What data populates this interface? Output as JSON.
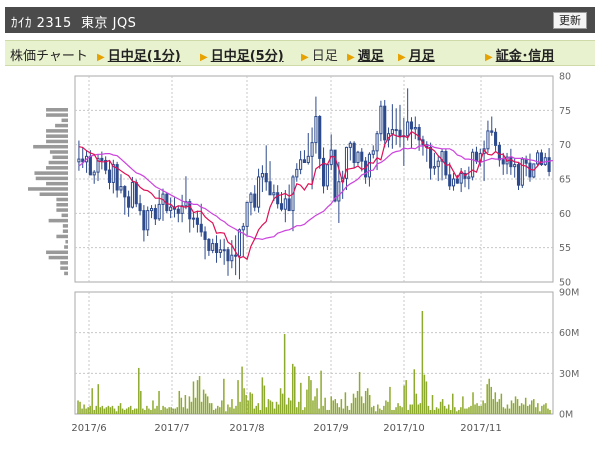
{
  "header": {
    "title": "ｶｲｶ 2315  東京 JQS",
    "refresh_label": "更新"
  },
  "tabs": {
    "label": "株価チャート",
    "items": [
      {
        "label": "日中足(1分)",
        "link": true
      },
      {
        "label": "日中足(5分)",
        "link": true
      },
      {
        "label": "日足",
        "link": false
      },
      {
        "label": "週足",
        "link": true
      },
      {
        "label": "月足",
        "link": true
      },
      {
        "label": "証金･信用",
        "link": true
      }
    ]
  },
  "colors": {
    "candle": "#2d4a8c",
    "ma_short": "#dd1155",
    "ma_long": "#cc44dd",
    "volume": "#8eaa2e",
    "volume_profile": "#999999",
    "grid": "#c8c8c8"
  },
  "chart_data": {
    "type": "candlestick",
    "price_axis": {
      "ticks": [
        "80",
        "75",
        "70",
        "65",
        "60",
        "55",
        "50"
      ],
      "range": [
        50,
        80
      ]
    },
    "volume_axis": {
      "ticks": [
        "90M",
        "60M",
        "30M",
        "0M"
      ],
      "range": [
        0,
        90
      ]
    },
    "x_labels": [
      "2017/6",
      "2017/7",
      "2017/8",
      "2017/9",
      "2017/10",
      "2017/11"
    ],
    "ohlc": [
      [
        67.5,
        70.6,
        66.2,
        67.9
      ],
      [
        67.9,
        69.6,
        66.6,
        67.5
      ],
      [
        67.5,
        69.2,
        65.9,
        68.3
      ],
      [
        68.3,
        69.2,
        65.6,
        65.6
      ],
      [
        65.6,
        66.3,
        64.3,
        66.0
      ],
      [
        66.0,
        68.6,
        64.7,
        68.0
      ],
      [
        68.0,
        69.0,
        66.4,
        67.7
      ],
      [
        67.7,
        68.3,
        65.7,
        66.3
      ],
      [
        66.3,
        67.7,
        63.5,
        64.5
      ],
      [
        64.5,
        67.8,
        62.9,
        67.1
      ],
      [
        67.1,
        67.5,
        62.3,
        63.4
      ],
      [
        63.4,
        65.7,
        62.9,
        63.9
      ],
      [
        63.9,
        64.1,
        59.8,
        62.4
      ],
      [
        62.4,
        63.3,
        59.5,
        60.9
      ],
      [
        60.9,
        65.3,
        60.7,
        64.5
      ],
      [
        64.5,
        64.9,
        60.9,
        61.4
      ],
      [
        61.4,
        62.7,
        59.7,
        60.4
      ],
      [
        60.4,
        61.2,
        55.9,
        57.6
      ],
      [
        57.6,
        61.0,
        56.7,
        60.4
      ],
      [
        60.4,
        61.2,
        59.3,
        60.7
      ],
      [
        60.7,
        61.3,
        58.3,
        59.2
      ],
      [
        59.2,
        63.4,
        58.9,
        61.3
      ],
      [
        61.3,
        63.6,
        58.9,
        62.8
      ],
      [
        62.8,
        63.0,
        60.0,
        60.4
      ],
      [
        60.4,
        62.3,
        59.3,
        60.9
      ],
      [
        60.9,
        62.3,
        59.4,
        60.6
      ],
      [
        60.6,
        61.1,
        58.7,
        60.0
      ],
      [
        60.0,
        62.7,
        58.7,
        61.1
      ],
      [
        61.1,
        65.4,
        60.6,
        61.7
      ],
      [
        61.7,
        62.1,
        57.2,
        59.2
      ],
      [
        59.2,
        60.2,
        57.9,
        59.3
      ],
      [
        59.3,
        60.4,
        57.2,
        58.4
      ],
      [
        58.4,
        61.4,
        56.6,
        57.3
      ],
      [
        57.3,
        58.1,
        53.3,
        56.2
      ],
      [
        56.2,
        56.4,
        53.8,
        54.6
      ],
      [
        54.6,
        56.3,
        54.2,
        55.6
      ],
      [
        55.6,
        56.8,
        52.8,
        54.3
      ],
      [
        54.3,
        56.2,
        53.5,
        54.7
      ],
      [
        54.7,
        56.3,
        52.5,
        54.7
      ],
      [
        54.7,
        55.1,
        50.9,
        53.1
      ],
      [
        53.1,
        56.1,
        52.0,
        53.9
      ],
      [
        53.9,
        56.8,
        51.0,
        53.8
      ],
      [
        53.8,
        57.8,
        50.4,
        57.6
      ],
      [
        57.6,
        58.6,
        53.7,
        58.1
      ],
      [
        58.1,
        61.6,
        56.8,
        61.6
      ],
      [
        61.6,
        63.1,
        59.7,
        62.8
      ],
      [
        62.8,
        64.1,
        60.3,
        60.9
      ],
      [
        60.9,
        66.5,
        60.1,
        65.3
      ],
      [
        65.3,
        67.0,
        63.1,
        65.8
      ],
      [
        65.8,
        69.9,
        63.3,
        64.6
      ],
      [
        64.6,
        67.6,
        62.7,
        62.7
      ],
      [
        62.7,
        64.2,
        61.8,
        63.0
      ],
      [
        63.0,
        64.1,
        60.7,
        61.4
      ],
      [
        61.4,
        63.1,
        60.3,
        60.6
      ],
      [
        60.6,
        63.4,
        58.7,
        62.1
      ],
      [
        62.1,
        64.2,
        60.5,
        60.4
      ],
      [
        60.4,
        65.6,
        57.4,
        65.3
      ],
      [
        65.3,
        67.3,
        64.6,
        66.4
      ],
      [
        66.4,
        69.1,
        65.7,
        67.8
      ],
      [
        67.8,
        69.2,
        67.4,
        67.4
      ],
      [
        67.4,
        71.7,
        67.1,
        68.3
      ],
      [
        68.3,
        72.5,
        63.5,
        70.3
      ],
      [
        70.3,
        77.0,
        68.7,
        74.1
      ],
      [
        74.1,
        74.3,
        66.5,
        68.0
      ],
      [
        68.0,
        69.6,
        62.9,
        64.0
      ],
      [
        64.0,
        67.2,
        63.4,
        67.1
      ],
      [
        67.1,
        71.5,
        66.3,
        69.2
      ],
      [
        69.2,
        69.2,
        61.6,
        61.8
      ],
      [
        61.8,
        67.5,
        58.6,
        64.6
      ],
      [
        64.6,
        66.2,
        62.1,
        65.1
      ],
      [
        65.1,
        69.7,
        63.4,
        69.6
      ],
      [
        69.6,
        70.5,
        67.7,
        70.2
      ],
      [
        70.2,
        70.5,
        66.6,
        67.4
      ],
      [
        67.4,
        69.1,
        67.0,
        68.9
      ],
      [
        68.9,
        69.5,
        66.1,
        67.6
      ],
      [
        67.6,
        68.2,
        64.3,
        65.3
      ],
      [
        65.3,
        68.9,
        63.9,
        68.6
      ],
      [
        68.6,
        69.9,
        68.0,
        69.1
      ],
      [
        69.1,
        72.0,
        66.3,
        71.6
      ],
      [
        71.6,
        76.4,
        70.5,
        75.6
      ],
      [
        75.6,
        76.5,
        69.6,
        70.7
      ],
      [
        70.7,
        72.5,
        69.6,
        71.6
      ],
      [
        71.6,
        75.9,
        69.4,
        72.2
      ],
      [
        72.2,
        75.3,
        70.0,
        72.1
      ],
      [
        72.1,
        75.8,
        69.6,
        71.2
      ],
      [
        71.2,
        73.9,
        66.9,
        71.3
      ],
      [
        71.3,
        78.2,
        70.6,
        73.3
      ],
      [
        73.3,
        74.0,
        69.5,
        72.3
      ],
      [
        72.3,
        74.1,
        70.8,
        72.5
      ],
      [
        72.5,
        73.0,
        69.1,
        70.7
      ],
      [
        70.7,
        71.3,
        68.4,
        70.0
      ],
      [
        70.0,
        70.5,
        67.5,
        69.6
      ],
      [
        69.6,
        70.3,
        64.9,
        66.6
      ],
      [
        66.6,
        68.8,
        65.6,
        66.8
      ],
      [
        66.8,
        68.3,
        64.7,
        67.6
      ],
      [
        67.6,
        69.4,
        64.8,
        69.0
      ],
      [
        69.0,
        69.4,
        65.0,
        65.6
      ],
      [
        65.6,
        67.4,
        63.4,
        64.0
      ],
      [
        64.0,
        65.9,
        63.3,
        65.0
      ],
      [
        65.0,
        65.6,
        64.3,
        64.4
      ],
      [
        64.4,
        66.6,
        63.1,
        65.8
      ],
      [
        65.8,
        66.3,
        63.8,
        65.1
      ],
      [
        65.1,
        66.8,
        63.5,
        65.3
      ],
      [
        65.3,
        69.4,
        64.8,
        68.9
      ],
      [
        68.9,
        69.7,
        67.2,
        67.6
      ],
      [
        67.6,
        69.4,
        66.8,
        68.7
      ],
      [
        68.7,
        70.6,
        64.7,
        69.4
      ],
      [
        69.4,
        73.5,
        68.8,
        72.0
      ],
      [
        72.0,
        74.1,
        71.3,
        71.8
      ],
      [
        71.8,
        72.4,
        69.1,
        69.9
      ],
      [
        69.9,
        70.4,
        66.8,
        67.8
      ],
      [
        67.8,
        68.8,
        65.6,
        67.2
      ],
      [
        67.2,
        68.8,
        65.7,
        68.2
      ],
      [
        68.2,
        69.4,
        65.6,
        66.8
      ],
      [
        66.8,
        68.1,
        65.2,
        67.1
      ],
      [
        67.1,
        67.5,
        63.4,
        64.1
      ],
      [
        64.1,
        68.2,
        63.7,
        67.9
      ],
      [
        67.9,
        68.4,
        65.4,
        67.3
      ],
      [
        67.3,
        68.7,
        64.6,
        65.3
      ],
      [
        65.3,
        67.2,
        65.1,
        67.2
      ],
      [
        67.2,
        69.2,
        66.8,
        68.8
      ],
      [
        68.8,
        69.3,
        66.9,
        67.1
      ],
      [
        67.1,
        68.8,
        66.9,
        68.1
      ],
      [
        68.1,
        69.5,
        65.4,
        66.1
      ]
    ],
    "ma_short": [
      69.7,
      69.6,
      69.1,
      68.8,
      68.6,
      67.6,
      67.5,
      67.5,
      67.7,
      66.8,
      66.6,
      66.2,
      65.8,
      65.5,
      64.7,
      64.5,
      63.8,
      63.4,
      63.3,
      62.9,
      62.2,
      62.2,
      62.0,
      61.4,
      61.3,
      60.8,
      61.1,
      61.0,
      60.9,
      61.1,
      60.1,
      60.3,
      60.3,
      59.5,
      59.0,
      58.6,
      57.1,
      57.2,
      57.1,
      55.8,
      55.4,
      54.4,
      53.5,
      53.7,
      53.3,
      55.2,
      56.3,
      57.6,
      58.3,
      58.8,
      60.9,
      62.1,
      62.6,
      62.7,
      62.9,
      62.5,
      62.8,
      64.3,
      64.1,
      63.4,
      64.3,
      64.2,
      66.5,
      66.9,
      67.3,
      67.1,
      68.3,
      68.2,
      66.5,
      64.5,
      66.4,
      66.5,
      66.6,
      66.9,
      66.4,
      66.6,
      67.4,
      67.3,
      68.1,
      67.8,
      70.0,
      71.0,
      71.5,
      71.3,
      71.1,
      71.3,
      71.0,
      71.9,
      71.6,
      71.2,
      70.2,
      69.5,
      69.5,
      69.1,
      68.4,
      67.8,
      67.0,
      67.1,
      66.1,
      65.1,
      66.2,
      65.5,
      65.9,
      66.3,
      66.0,
      67.6,
      69.2,
      68.6,
      68.5,
      69.0,
      68.6,
      68.6,
      67.6,
      67.8,
      67.5,
      67.4,
      67.0,
      66.9,
      66.4,
      66.3,
      66.9,
      67.6
    ],
    "ma_long": [
      66.9,
      67.3,
      67.9,
      68.3,
      68.5,
      68.6,
      68.6,
      68.7,
      68.7,
      68.5,
      68.4,
      67.9,
      67.4,
      66.9,
      66.4,
      65.9,
      65.7,
      65.4,
      64.9,
      64.4,
      63.9,
      63.6,
      63.3,
      63.0,
      62.7,
      62.4,
      62.1,
      61.8,
      61.6,
      61.5,
      61.3,
      61.3,
      60.9,
      60.7,
      60.3,
      59.9,
      59.6,
      59.1,
      58.8,
      58.3,
      58.0,
      57.7,
      57.3,
      57.1,
      56.7,
      56.6,
      56.3,
      56.3,
      56.2,
      56.4,
      56.5,
      56.6,
      57.1,
      57.3,
      57.5,
      57.6,
      57.9,
      58.2,
      58.2,
      58.4,
      58.9,
      59.3,
      59.7,
      60.0,
      60.3,
      60.9,
      61.4,
      62.2,
      62.6,
      63.2,
      63.9,
      64.3,
      64.6,
      65.0,
      65.6,
      65.8,
      66.2,
      66.3,
      67.2,
      67.4,
      67.8,
      68.3,
      68.8,
      69.0,
      69.1,
      69.5,
      69.4,
      69.5,
      69.4,
      69.8,
      69.8,
      69.9,
      69.9,
      69.6,
      69.5,
      69.4,
      69.4,
      69.4,
      69.1,
      68.5,
      68.3,
      67.9,
      67.9,
      67.8,
      67.6,
      67.4,
      67.6,
      67.8,
      68.0,
      67.9,
      67.9,
      68.0,
      67.9,
      68.3,
      68.0,
      68.0,
      68.0,
      67.9,
      67.8,
      67.7,
      67.5,
      67.4,
      67.5,
      67.6,
      67.7
    ],
    "volume": [
      10,
      9,
      4,
      7,
      4,
      5,
      6,
      19,
      3,
      6,
      22,
      5,
      6,
      4,
      5,
      6,
      5,
      6,
      4,
      2,
      6,
      8,
      4,
      3,
      4,
      5,
      6,
      3,
      4,
      4,
      34,
      17,
      4,
      3,
      6,
      4,
      3,
      10,
      4,
      6,
      17,
      3,
      6,
      5,
      4,
      5,
      5,
      4,
      4,
      5,
      17,
      12,
      5,
      14,
      4,
      13,
      9,
      24,
      12,
      25,
      28,
      9,
      18,
      15,
      13,
      8,
      8,
      3,
      4,
      6,
      5,
      10,
      26,
      2,
      7,
      5,
      11,
      4,
      6,
      25,
      9,
      35,
      19,
      14,
      10,
      16,
      15,
      4,
      6,
      8,
      3,
      27,
      21,
      5,
      11,
      10,
      9,
      4,
      9,
      7,
      19,
      15,
      59,
      7,
      12,
      10,
      37,
      35,
      5,
      9,
      23,
      3,
      5,
      18,
      28,
      25,
      10,
      13,
      19,
      4,
      32,
      6,
      12,
      3,
      3,
      13,
      10,
      11,
      8,
      5,
      11,
      4,
      16,
      6,
      3,
      8,
      15,
      12,
      17,
      31,
      13,
      8,
      17,
      19,
      14,
      5,
      6,
      2,
      7,
      4,
      3,
      6,
      10,
      9,
      20,
      3,
      3,
      5,
      8,
      6,
      5,
      21,
      25,
      3,
      7,
      7,
      33,
      15,
      7,
      8,
      76,
      29,
      24,
      6,
      3,
      14,
      3,
      5,
      4,
      9,
      11,
      6,
      4,
      7,
      3,
      15,
      5,
      2,
      3,
      5,
      13,
      4,
      4,
      5,
      6,
      16,
      7,
      8,
      6,
      6,
      10,
      8,
      22,
      26,
      20,
      11,
      16,
      9,
      11,
      15,
      5,
      4,
      7,
      4,
      10,
      8,
      13,
      11,
      6,
      8,
      7,
      12,
      6,
      7,
      10,
      11,
      5,
      8,
      2,
      6,
      7,
      8,
      4,
      3
    ],
    "volume_profile": [
      17,
      17,
      5,
      10,
      17,
      17,
      17,
      27,
      14,
      12,
      15,
      17,
      26,
      25,
      17,
      31,
      22,
      9,
      9,
      9,
      5,
      15,
      4,
      4,
      9,
      2,
      3,
      17,
      15,
      6,
      6,
      3
    ]
  }
}
